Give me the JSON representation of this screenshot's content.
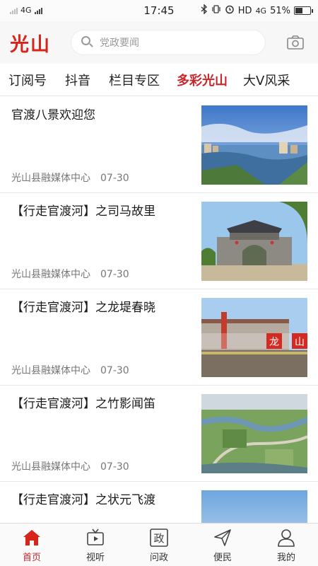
{
  "status_bar": {
    "network": "4G",
    "time": "17:45",
    "hd_label": "HD",
    "network_right": "4G",
    "battery": "51%",
    "battery_level": 0.51
  },
  "header": {
    "logo": "光山",
    "search_placeholder": "党政要闻",
    "camera_icon": "camera-icon"
  },
  "tabs": [
    {
      "label": "订阅号",
      "active": false
    },
    {
      "label": "抖音",
      "active": false
    },
    {
      "label": "栏目专区",
      "active": false
    },
    {
      "label": "多彩光山",
      "active": true
    },
    {
      "label": "大V风采",
      "active": false
    }
  ],
  "feed": [
    {
      "title": "官渡八景欢迎您",
      "source": "光山县融媒体中心",
      "date": "07-30",
      "image": "river-city-photo"
    },
    {
      "title": "【行走官渡河】之司马故里",
      "source": "光山县融媒体中心",
      "date": "07-30",
      "image": "archway-gate-photo"
    },
    {
      "title": "【行走官渡河】之龙堤春晓",
      "source": "光山县融媒体中心",
      "date": "07-30",
      "image": "riverside-building-photo"
    },
    {
      "title": "【行走官渡河】之竹影闻笛",
      "source": "光山县融媒体中心",
      "date": "07-30",
      "image": "aerial-river-photo"
    },
    {
      "title": "【行走官渡河】之状元飞渡",
      "source": "",
      "date": "",
      "image": "sky-photo"
    }
  ],
  "photo_text": {
    "sign_1": "龙",
    "sign_2": "山"
  },
  "bottom_nav": [
    {
      "label": "首页",
      "icon": "home-icon",
      "active": true
    },
    {
      "label": "视听",
      "icon": "tv-icon",
      "active": false
    },
    {
      "label": "问政",
      "icon": "zheng-icon",
      "glyph": "政",
      "active": false
    },
    {
      "label": "便民",
      "icon": "send-icon",
      "active": false
    },
    {
      "label": "我的",
      "icon": "user-icon",
      "active": false
    }
  ],
  "colors": {
    "brand_red": "#d8251c",
    "active_tab": "#c9262c"
  }
}
